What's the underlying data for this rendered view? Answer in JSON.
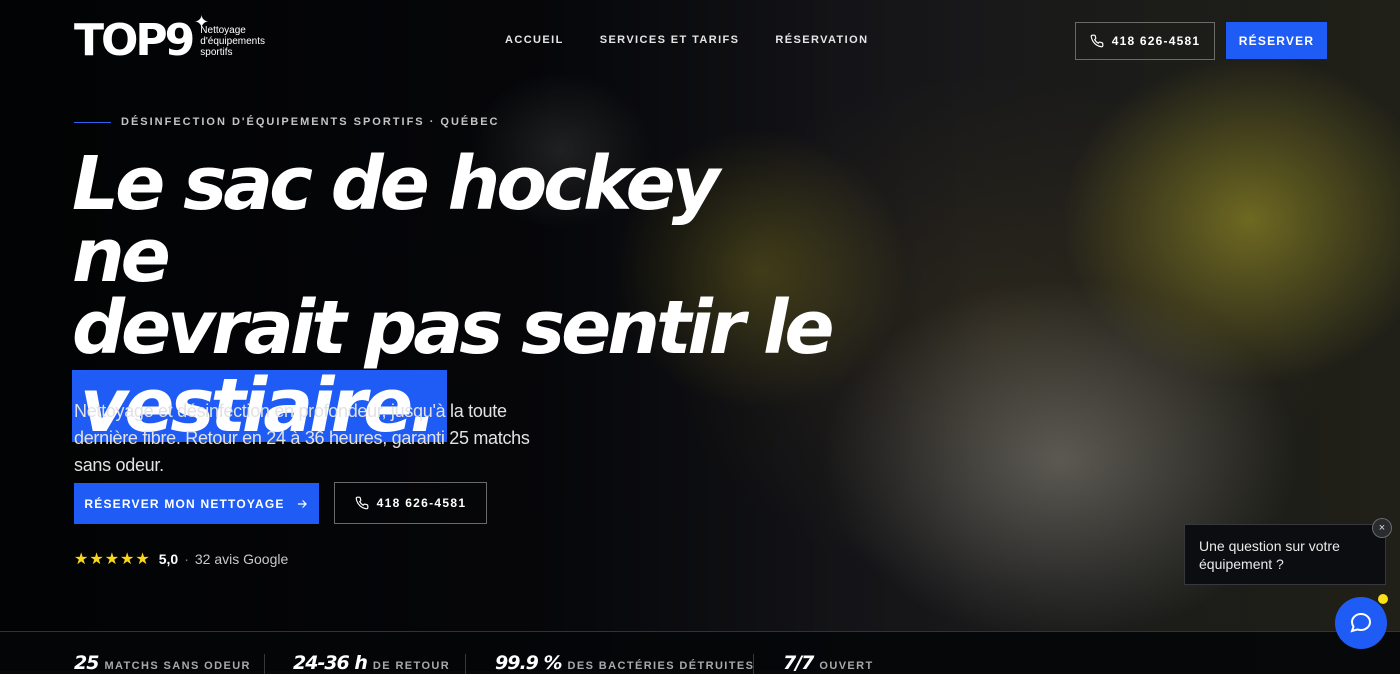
{
  "header": {
    "logo_text": "TOP9",
    "logo_tagline": "Nettoyage d'équipements sportifs",
    "nav": [
      "ACCUEIL",
      "SERVICES ET TARIFS",
      "RÉSERVATION"
    ],
    "phone": "418 626-4581",
    "book_label": "RÉSERVER"
  },
  "hero": {
    "eyebrow": "DÉSINFECTION D'ÉQUIPEMENTS SPORTIFS · QUÉBEC",
    "headline_line1": "Le sac de hockey ne",
    "headline_line2": "devrait pas sentir le",
    "headline_highlight": "vestiaire.",
    "lede": "Nettoyage et désinfection en profondeur, jusqu'à la toute dernière fibre. Retour en 24 à 36 heures, garanti 25 matchs sans odeur.",
    "cta_primary": "RÉSERVER MON NETTOYAGE",
    "cta_phone": "418 626-4581",
    "rating_stars": "★★★★★",
    "rating_score": "5,0",
    "rating_separator": "·",
    "rating_reviews": "32 avis Google"
  },
  "stats": [
    {
      "value": "25",
      "label": "MATCHS SANS ODEUR"
    },
    {
      "value": "24-36 h",
      "label": "DE RETOUR"
    },
    {
      "value": "99.9 %",
      "label": "DES BACTÉRIES DÉTRUITES"
    },
    {
      "value": "7/7",
      "label": "OUVERT"
    }
  ],
  "chat": {
    "message": "Une question sur votre équipement ?",
    "close_symbol": "×"
  },
  "colors": {
    "accent": "#1f5cf5",
    "star": "#f9d71c",
    "notification": "#f7e01a"
  }
}
